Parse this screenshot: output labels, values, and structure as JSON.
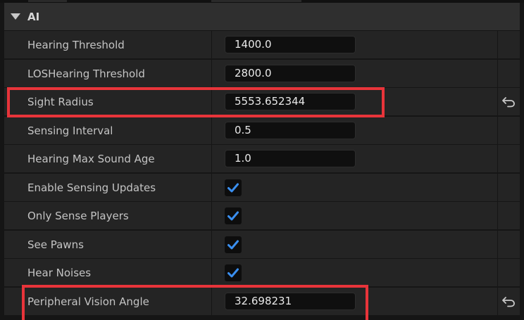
{
  "category": {
    "title": "AI"
  },
  "properties": [
    {
      "label": "Hearing Threshold",
      "type": "number",
      "value": "1400.0",
      "modified": false
    },
    {
      "label": "LOSHearing Threshold",
      "type": "number",
      "value": "2800.0",
      "modified": false
    },
    {
      "label": "Sight Radius",
      "type": "number",
      "value": "5553.652344",
      "modified": true
    },
    {
      "label": "Sensing Interval",
      "type": "number",
      "value": "0.5",
      "modified": false
    },
    {
      "label": "Hearing Max Sound Age",
      "type": "number",
      "value": "1.0",
      "modified": false
    },
    {
      "label": "Enable Sensing Updates",
      "type": "checkbox",
      "checked": true,
      "modified": false
    },
    {
      "label": "Only Sense Players",
      "type": "checkbox",
      "checked": true,
      "modified": false
    },
    {
      "label": "See Pawns",
      "type": "checkbox",
      "checked": true,
      "modified": false
    },
    {
      "label": "Hear Noises",
      "type": "checkbox",
      "checked": true,
      "modified": false
    },
    {
      "label": "Peripheral Vision Angle",
      "type": "number",
      "value": "32.698231",
      "modified": true
    }
  ],
  "colors": {
    "highlight": "#e8343a",
    "checkmark": "#3a8ff0"
  },
  "icons": {
    "expand": "triangle-down-icon",
    "reset": "reset-arrow-icon",
    "check": "checkmark-icon"
  }
}
